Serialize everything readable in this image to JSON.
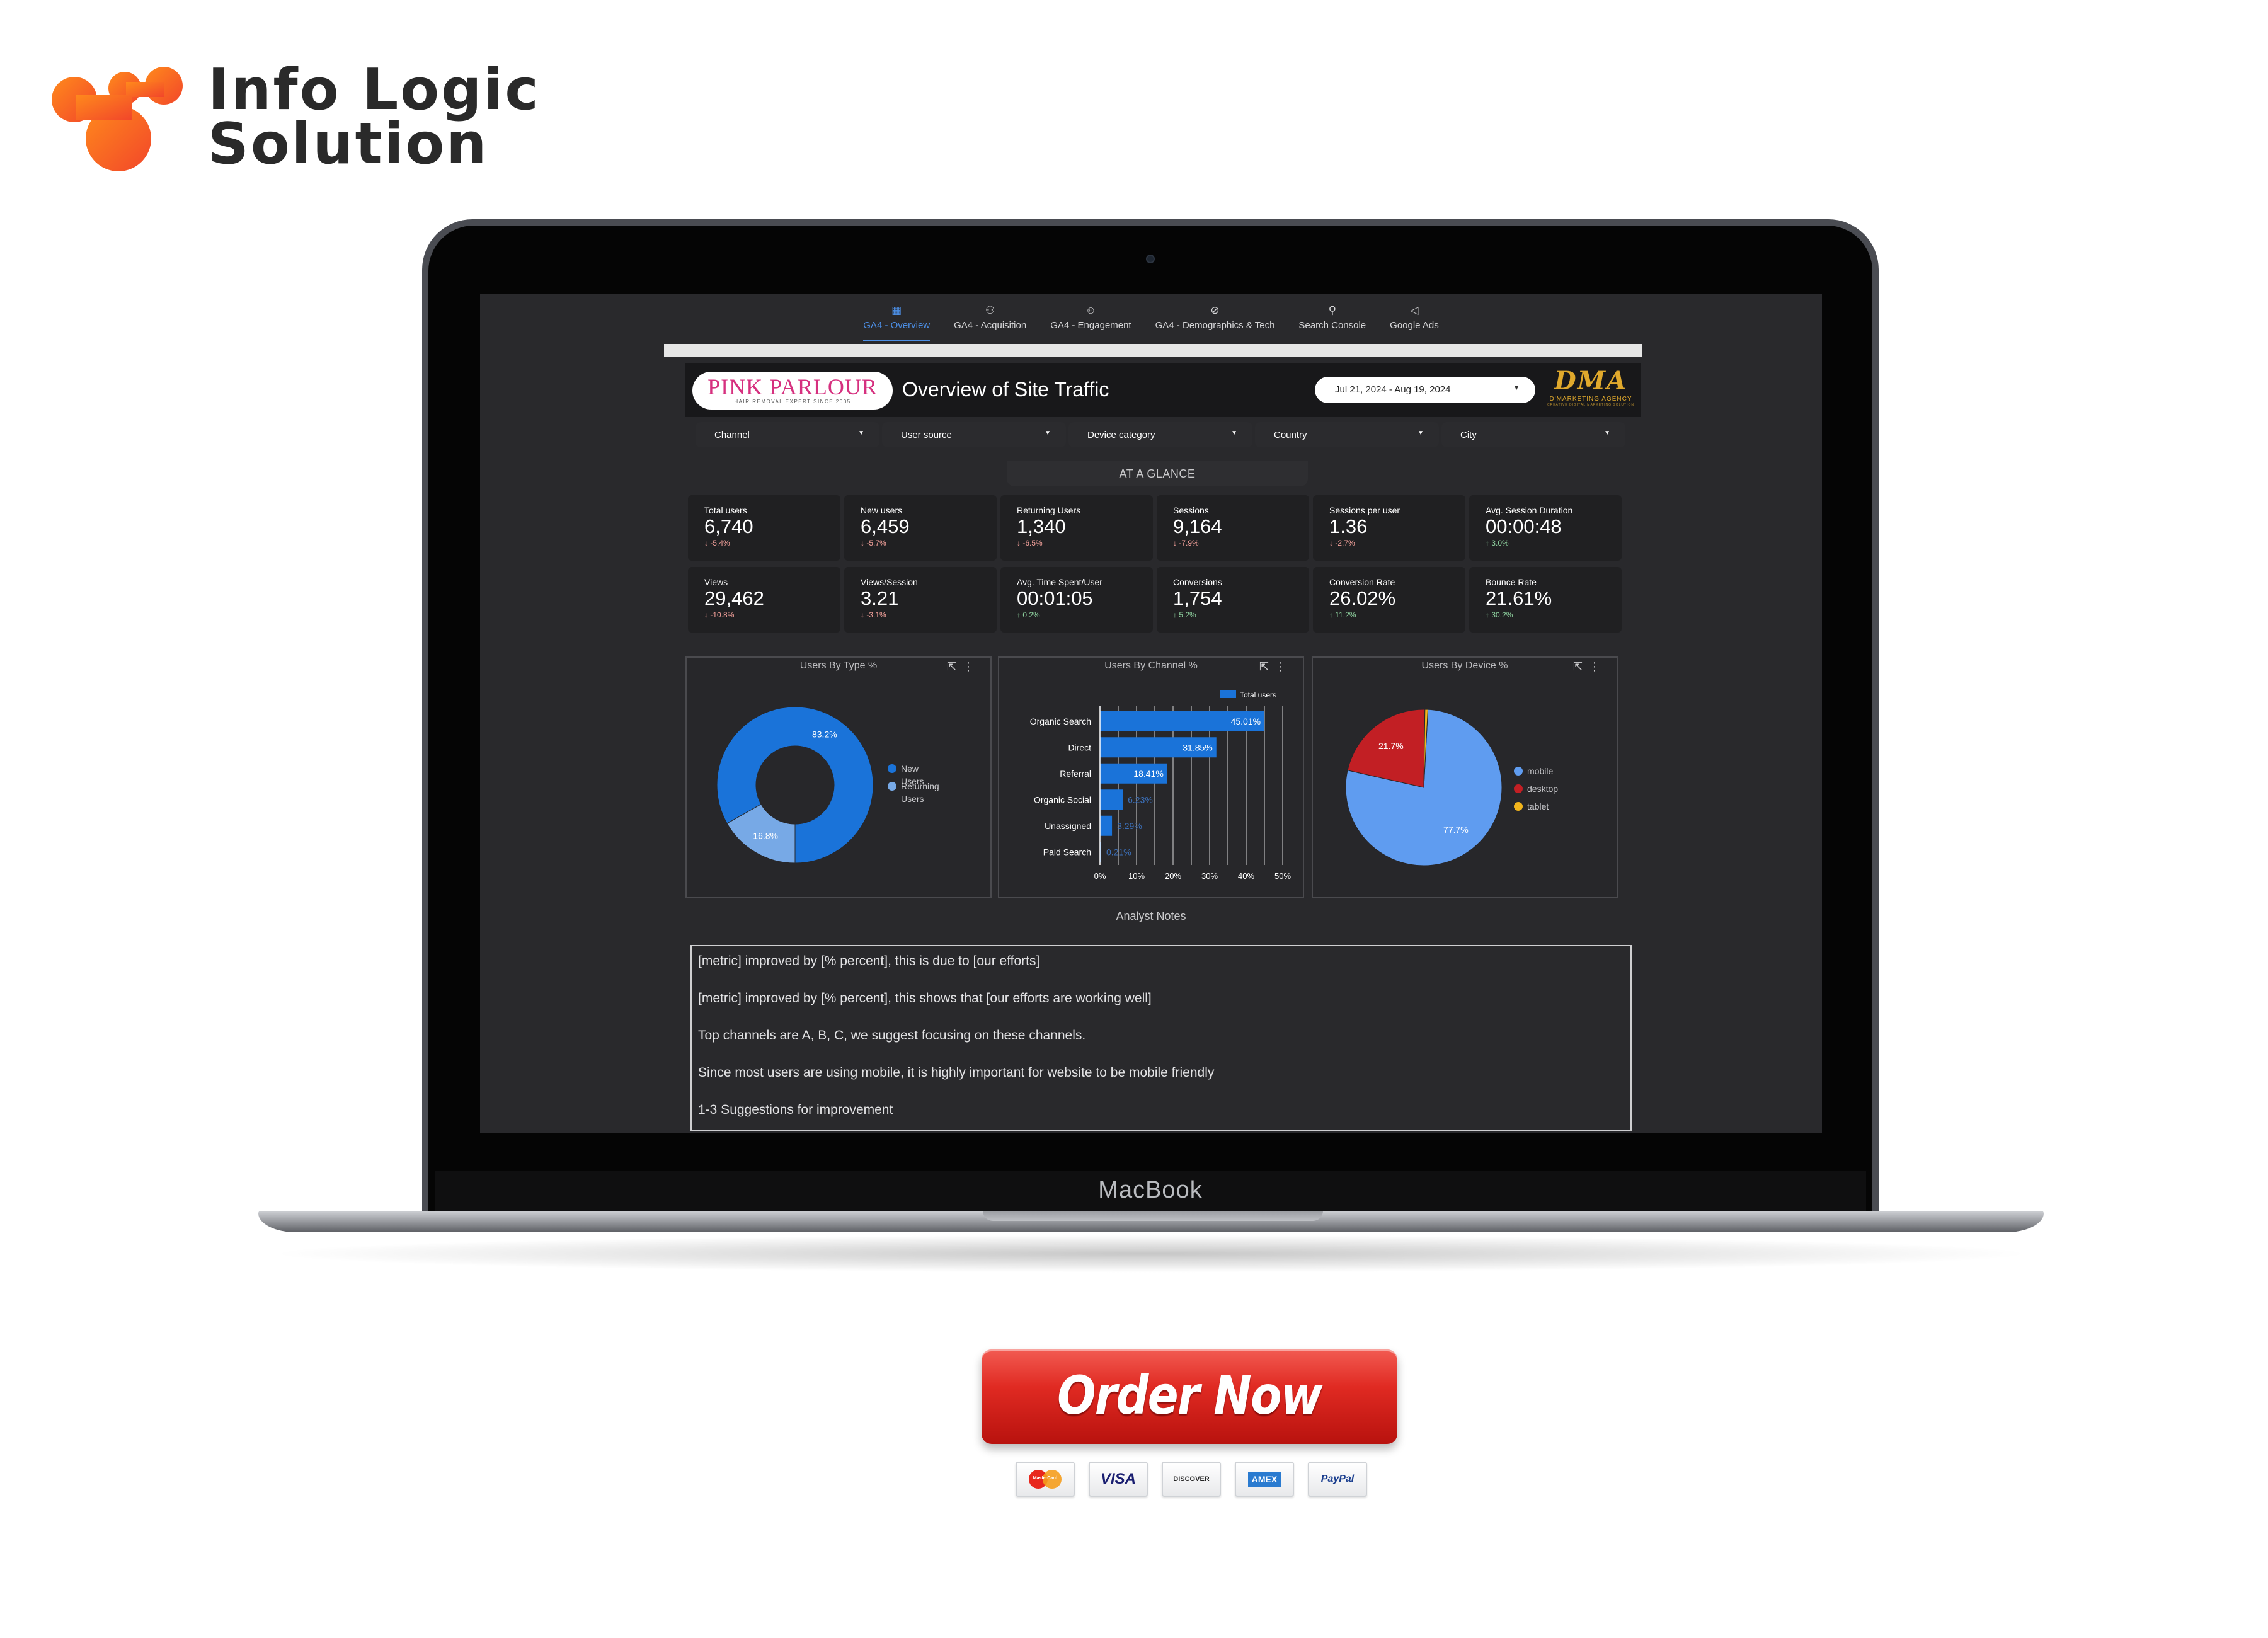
{
  "brand": {
    "line1": "Info Logic",
    "line2": "Solution",
    "colors": {
      "orange": "#f46b2e",
      "dark": "#2a2a2a"
    }
  },
  "device": {
    "label": "MacBook"
  },
  "nav": {
    "tabs": [
      {
        "label": "GA4 - Overview",
        "icon": "dashboard-icon",
        "glyph": "▦",
        "active": true
      },
      {
        "label": "GA4 - Acquisition",
        "icon": "people-icon",
        "glyph": "⚇",
        "active": false
      },
      {
        "label": "GA4 - Engagement",
        "icon": "user-circle-icon",
        "glyph": "☺",
        "active": false
      },
      {
        "label": "GA4 - Demographics & Tech",
        "icon": "compass-icon",
        "glyph": "⊘",
        "active": false
      },
      {
        "label": "Search Console",
        "icon": "search-icon",
        "glyph": "⚲",
        "active": false
      },
      {
        "label": "Google Ads",
        "icon": "megaphone-icon",
        "glyph": "◁",
        "active": false
      }
    ]
  },
  "report": {
    "client_logo": {
      "title": "PINK PARLOUR",
      "subtitle": "HAIR REMOVAL EXPERT SINCE 2005"
    },
    "title": "Overview of Site Traffic",
    "date_range": "Jul 21, 2024 - Aug 19, 2024",
    "agency_logo": {
      "mark": "DMA",
      "name": "D'MARKETING AGENCY",
      "tagline": "CREATIVE DIGITAL MARKETING SOLUTION"
    }
  },
  "filters": [
    {
      "label": "Channel"
    },
    {
      "label": "User source"
    },
    {
      "label": "Device category"
    },
    {
      "label": "Country"
    },
    {
      "label": "City"
    }
  ],
  "glance_title": "AT A GLANCE",
  "kpis": [
    {
      "label": "Total users",
      "value": "6,740",
      "delta": "-5.4%",
      "dir": "down"
    },
    {
      "label": "New users",
      "value": "6,459",
      "delta": "-5.7%",
      "dir": "down"
    },
    {
      "label": "Returning Users",
      "value": "1,340",
      "delta": "-6.5%",
      "dir": "down"
    },
    {
      "label": "Sessions",
      "value": "9,164",
      "delta": "-7.9%",
      "dir": "down"
    },
    {
      "label": "Sessions per user",
      "value": "1.36",
      "delta": "-2.7%",
      "dir": "down"
    },
    {
      "label": "Avg. Session Duration",
      "value": "00:00:48",
      "delta": "3.0%",
      "dir": "up"
    },
    {
      "label": "Views",
      "value": "29,462",
      "delta": "-10.8%",
      "dir": "down"
    },
    {
      "label": "Views/Session",
      "value": "3.21",
      "delta": "-3.1%",
      "dir": "down"
    },
    {
      "label": "Avg. Time Spent/User",
      "value": "00:01:05",
      "delta": "0.2%",
      "dir": "up"
    },
    {
      "label": "Conversions",
      "value": "1,754",
      "delta": "5.2%",
      "dir": "up"
    },
    {
      "label": "Conversion Rate",
      "value": "26.02%",
      "delta": "11.2%",
      "dir": "up"
    },
    {
      "label": "Bounce Rate",
      "value": "21.61%",
      "delta": "30.2%",
      "dir": "up"
    }
  ],
  "chart_data": [
    {
      "type": "pie",
      "title": "Users By Type %",
      "donut": true,
      "categories": [
        "New Users",
        "Returning Users"
      ],
      "values": [
        83.2,
        16.8
      ],
      "labels": [
        "83.2%",
        "16.8%"
      ],
      "colors": [
        "#1a73d9",
        "#77a9e6"
      ],
      "legend": "right"
    },
    {
      "type": "bar",
      "orientation": "horizontal",
      "title": "Users By Channel %",
      "categories": [
        "Organic Search",
        "Direct",
        "Referral",
        "Organic Social",
        "Unassigned",
        "Paid Search"
      ],
      "series": [
        {
          "name": "Total users",
          "values": [
            45.01,
            31.85,
            18.41,
            6.23,
            3.29,
            0.21
          ]
        }
      ],
      "labels": [
        "45.01%",
        "31.85%",
        "18.41%",
        "6.23%",
        "3.29%",
        "0.21%"
      ],
      "xlim": [
        0,
        50
      ],
      "ticks": [
        "0%",
        "10%",
        "20%",
        "30%",
        "40%",
        "50%"
      ],
      "grid": true,
      "legend": "top-right",
      "color": "#1a73d9"
    },
    {
      "type": "pie",
      "title": "Users By Device %",
      "donut": false,
      "categories": [
        "mobile",
        "desktop",
        "tablet"
      ],
      "values": [
        77.7,
        21.7,
        0.6
      ],
      "labels": [
        "77.7%",
        "21.7%",
        ""
      ],
      "colors": [
        "#5f9cf0",
        "#c21f24",
        "#f2b51c"
      ],
      "legend": "right"
    }
  ],
  "notes": {
    "title": "Analyst Notes",
    "lines": [
      "[metric] improved by [% percent], this is due to [our efforts]",
      "[metric] improved by [% percent], this shows that [our efforts are working well]",
      "Top channels are A, B, C, we suggest focusing on these channels.",
      "Since most users are using mobile, it is highly important for website to be mobile friendly",
      "1-3 Suggestions for improvement"
    ]
  },
  "order_button": {
    "label": "Order Now",
    "color": "#e02a22"
  },
  "payment_cards": [
    {
      "name": "mastercard-card",
      "label": "MasterCard"
    },
    {
      "name": "visa-card",
      "label": "VISA"
    },
    {
      "name": "discover-card",
      "label": "DISCOVER"
    },
    {
      "name": "amex-card",
      "label": "AMEX"
    },
    {
      "name": "paypal-card",
      "label": "PayPal"
    }
  ]
}
